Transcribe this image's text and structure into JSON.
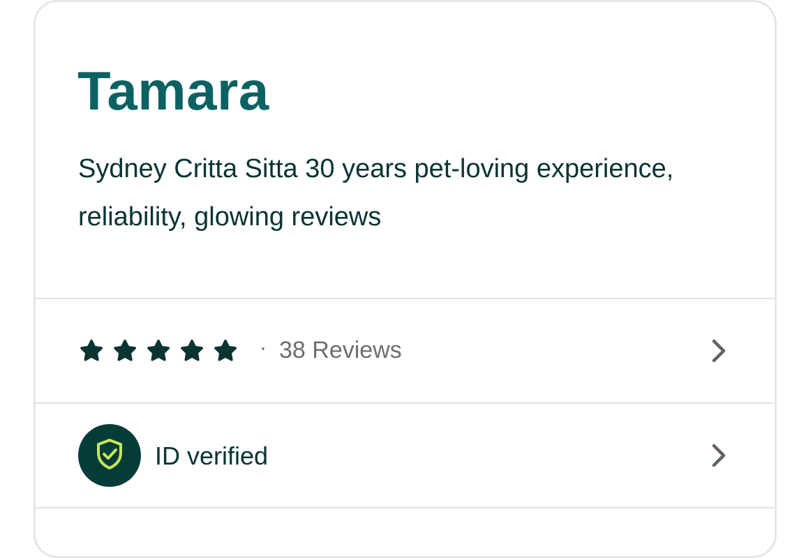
{
  "profile": {
    "name": "Tamara",
    "description": "Sydney Critta Sitta 30 years pet-loving experience, reliability, glowing reviews"
  },
  "reviews": {
    "rating": 5,
    "max_rating": 5,
    "separator": "·",
    "label": "38 Reviews"
  },
  "verification": {
    "label": "ID verified",
    "icon": "shield-check-icon"
  },
  "colors": {
    "name": "#0c6262",
    "text": "#0b3333",
    "star": "#0a3331",
    "badge_bg": "#063c38",
    "badge_icon": "#c8e85a",
    "muted": "#6b6f70"
  }
}
